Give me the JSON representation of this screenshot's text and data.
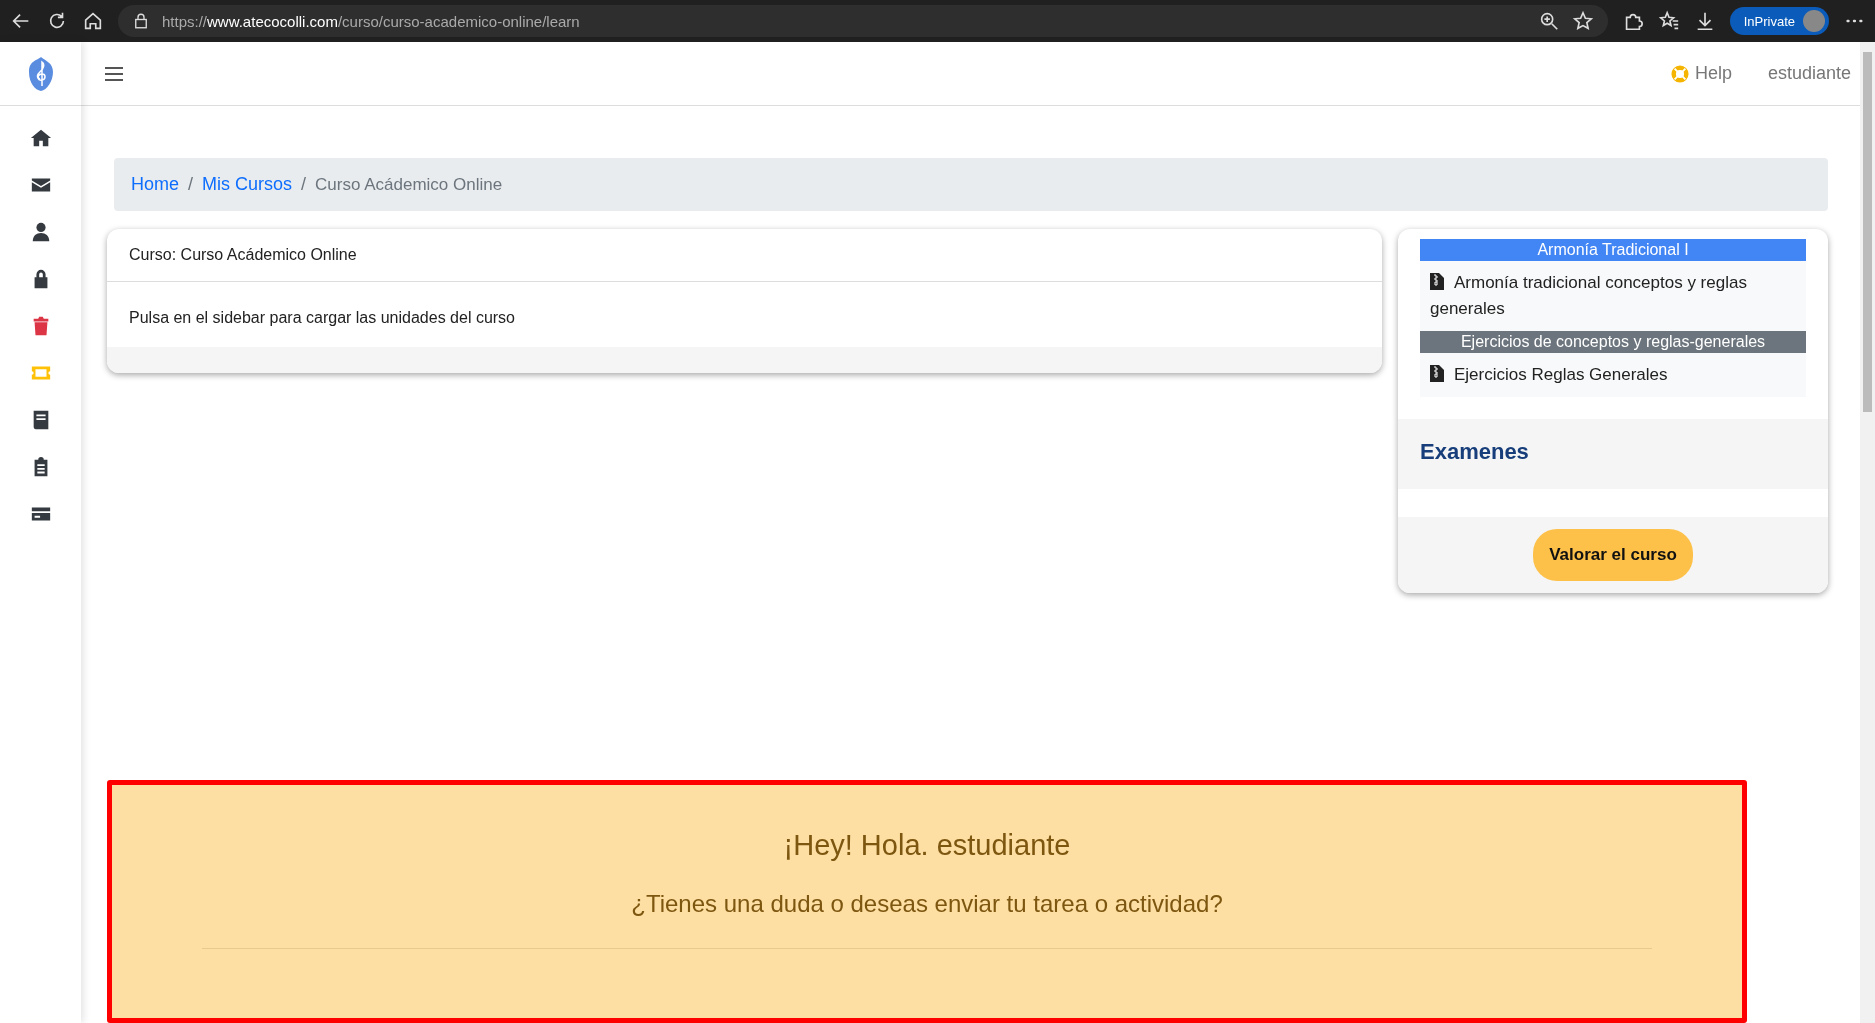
{
  "browser": {
    "url": "https://**www.atecocolli.com**/curso/curso-academico-online/learn",
    "profile_label": "InPrivate"
  },
  "sidebar": {
    "items": [
      {
        "kind": "home",
        "color": "#343a40"
      },
      {
        "kind": "mail",
        "color": "#343a40"
      },
      {
        "kind": "user",
        "color": "#343a40"
      },
      {
        "kind": "lock",
        "color": "#343a40"
      },
      {
        "kind": "trash",
        "color": "#dc3545"
      },
      {
        "kind": "ticket",
        "color": "#ffc107"
      },
      {
        "kind": "book",
        "color": "#343a40"
      },
      {
        "kind": "clipboard",
        "color": "#343a40"
      },
      {
        "kind": "card",
        "color": "#343a40"
      }
    ]
  },
  "header": {
    "help": "Help",
    "user": "estudiante"
  },
  "breadcrumb": [
    {
      "label": "Home",
      "kind": "link"
    },
    {
      "label": "/",
      "kind": "separator"
    },
    {
      "label": "Mis Cursos",
      "kind": "link"
    },
    {
      "label": "/",
      "kind": "separator"
    },
    {
      "label": "Curso Acádemico Online",
      "kind": "current"
    }
  ],
  "course_card": {
    "title": "Curso: Curso Acádemico Online",
    "body": "Pulsa en el sidebar para cargar las unidades del curso"
  },
  "units": [
    {
      "title": "Armonía Tradicional I",
      "color": "#4285f4",
      "lessons": [
        "Armonía tradicional conceptos y reglas generales"
      ]
    },
    {
      "title": "Ejercicios de conceptos y reglas-generales",
      "color": "#6c757d",
      "lessons": [
        "Ejercicios Reglas Generales"
      ]
    }
  ],
  "exams_title": "Examenes",
  "rate_button": "Valorar el curso",
  "alert": {
    "greeting": "¡Hey! Hola. estudiante",
    "question": "¿Tienes una duda o deseas enviar tu tarea o actividad?"
  }
}
